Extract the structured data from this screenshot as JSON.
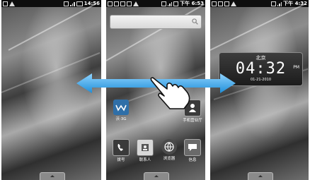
{
  "screens": {
    "left": {
      "status": {
        "time": "14:56"
      }
    },
    "center": {
      "status": {
        "time": "下午 6:53"
      },
      "search": {
        "placeholder": ""
      },
      "apps": [
        {
          "label": "沃·3G",
          "icon": "wo-3g-icon",
          "color": "#2f6fa8"
        },
        {
          "label": "手机营业厅",
          "icon": "person-icon",
          "color": "#3a3a3a"
        },
        {
          "label": "拨号",
          "icon": "phone-icon",
          "color": "#3a3a3a"
        },
        {
          "label": "联系人",
          "icon": "contacts-icon",
          "color": "#d8d8d8"
        },
        {
          "label": "浏览器",
          "icon": "globe-icon",
          "color": "#4a4a4a"
        },
        {
          "label": "信息",
          "icon": "message-icon",
          "color": "#6a6a6a"
        }
      ]
    },
    "right": {
      "status": {
        "time": "下午 4:32"
      },
      "clock": {
        "city": "北京",
        "time": "04:32",
        "ampm": "PM",
        "date": "01-21-2010"
      }
    }
  },
  "gesture": {
    "arrow_icon": "double-arrow-icon",
    "hand_icon": "pointing-hand-icon"
  }
}
